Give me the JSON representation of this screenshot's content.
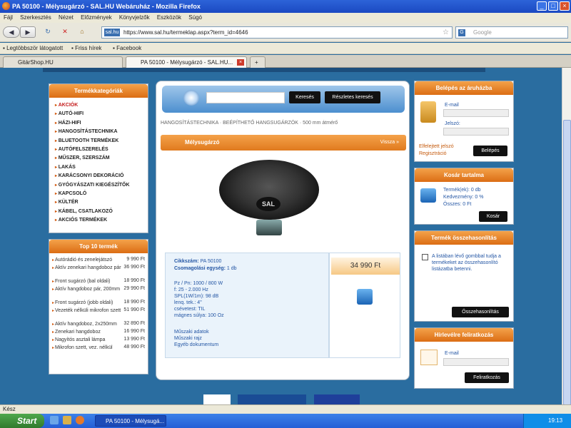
{
  "window": {
    "title": "PA 50100 - Mélysugárzó - SAL.HU Webáruház - Mozilla Firefox"
  },
  "menu": [
    "Fájl",
    "Szerkesztés",
    "Nézet",
    "Előzmények",
    "Könyvjelzők",
    "Eszközök",
    "Súgó"
  ],
  "nav": {
    "url_domain": "sal.hu",
    "url": "https://www.sal.hu/termeklap.aspx?term_id=4646",
    "search_placeholder": "Google"
  },
  "bookmarks": [
    "Legtöbbször látogatott",
    "Friss hírek",
    "Facebook"
  ],
  "tabs": [
    {
      "label": "GitárShop.HU"
    },
    {
      "label": "PA 50100 - Mélysugárzó - SAL.HU..."
    }
  ],
  "sidebar": {
    "categories_title": "Termékkategóriák",
    "categories": [
      "AKCIÓK",
      "AUTÓ-HIFI",
      "HÁZI-HIFI",
      "HANGOSÍTÁSTECHNIKA",
      "BLUETOOTH TERMÉKEK",
      "AUTÓFELSZERELÉS",
      "MŰSZER, SZERSZÁM",
      "LAKÁS",
      "KARÁCSONYI DEKORÁCIÓ",
      "GYÓGYÁSZATI KIEGÉSZÍTŐK",
      "KAPCSOLÓ",
      "KÜLTÉR",
      "KÁBEL, CSATLAKOZÓ",
      "AKCIÓS TERMÉKEK"
    ],
    "top10_title": "Top 10 termék",
    "top10": [
      {
        "name": "Autórádió és zenelejátszó",
        "price": "9 990 Ft"
      },
      {
        "name": "Aktív zenekari hangdoboz pár",
        "price": "36 990 Ft"
      },
      {
        "name": "Front sugárzó (bal oldali)",
        "price": "18 990 Ft"
      },
      {
        "name": "Aktív hangdoboz pár, 200mm",
        "price": "29 990 Ft"
      },
      {
        "name": "Front sugárzó (jobb oldali)",
        "price": "18 990 Ft"
      },
      {
        "name": "Vezeték nélküli mikrofon szett",
        "price": "51 990 Ft"
      },
      {
        "name": "Aktív hangdoboz, 2x250mm",
        "price": "32 890 Ft"
      },
      {
        "name": "Zenekari hangdoboz",
        "price": "16 990 Ft"
      },
      {
        "name": "Nagyítós asztali lámpa",
        "price": "13 990 Ft"
      },
      {
        "name": "Mikrofon szett, vez. nélkül",
        "price": "48 990 Ft"
      }
    ]
  },
  "search": {
    "button": "Keresés",
    "advanced": "Részletes keresés"
  },
  "breadcrumb": [
    "HANGOSÍTÁSTECHNIKA",
    "BEÉPÍTHETŐ HANGSUGÁRZÓK",
    "500 mm átmérő"
  ],
  "product": {
    "category_title": "Mélysugárzó",
    "back": "Vissza",
    "logo_text": "SAL",
    "code_label": "Cikkszám:",
    "code": "PA 50100",
    "pack_label": "Csomagolási egység:",
    "pack": "1 db",
    "specs": [
      "Pz / Pn: 1000 / 800 W",
      "f: 25 - 2.000 Hz",
      "SPL(1W/1m): 98 dB",
      "lenq. tek.: 4\"",
      "csévetest: TIL",
      "mágnes súlya: 100 Oz"
    ],
    "links": [
      "Műszaki adatok",
      "Műszaki rajz",
      "Egyéb dokumentum"
    ],
    "price": "34 990 Ft"
  },
  "login": {
    "title": "Belépés az áruházba",
    "email_label": "E-mail",
    "password_label": "Jelszó:",
    "forgot": "Elfelejtett jelszó",
    "register": "Regisztráció",
    "button": "Belépés"
  },
  "cart": {
    "title": "Kosár tartalma",
    "items_label": "Termék(ek):",
    "items": "0 db",
    "discount_label": "Kedvezmény:",
    "discount": "0 %",
    "total_label": "Összes:",
    "total": "0 Ft",
    "button": "Kosár"
  },
  "compare": {
    "title": "Termék összehasonlítás",
    "text": "A listában lévő gombbal tudja a termékeket az összehasonlító listázatba betenni.",
    "button": "Összehasonlítás"
  },
  "newsletter": {
    "title": "Hírlevélre feliratkozás",
    "email_label": "E-mail",
    "button": "Feliratkozás"
  },
  "status": {
    "text": "Kész"
  },
  "taskbar": {
    "start": "Start",
    "task": "PA 50100 - Mélysugá...",
    "clock": "19:13"
  },
  "colors": {
    "page_bg": "#2a6da0",
    "accent_orange": "#e07a1e",
    "title_blue": "#1b49c2"
  }
}
